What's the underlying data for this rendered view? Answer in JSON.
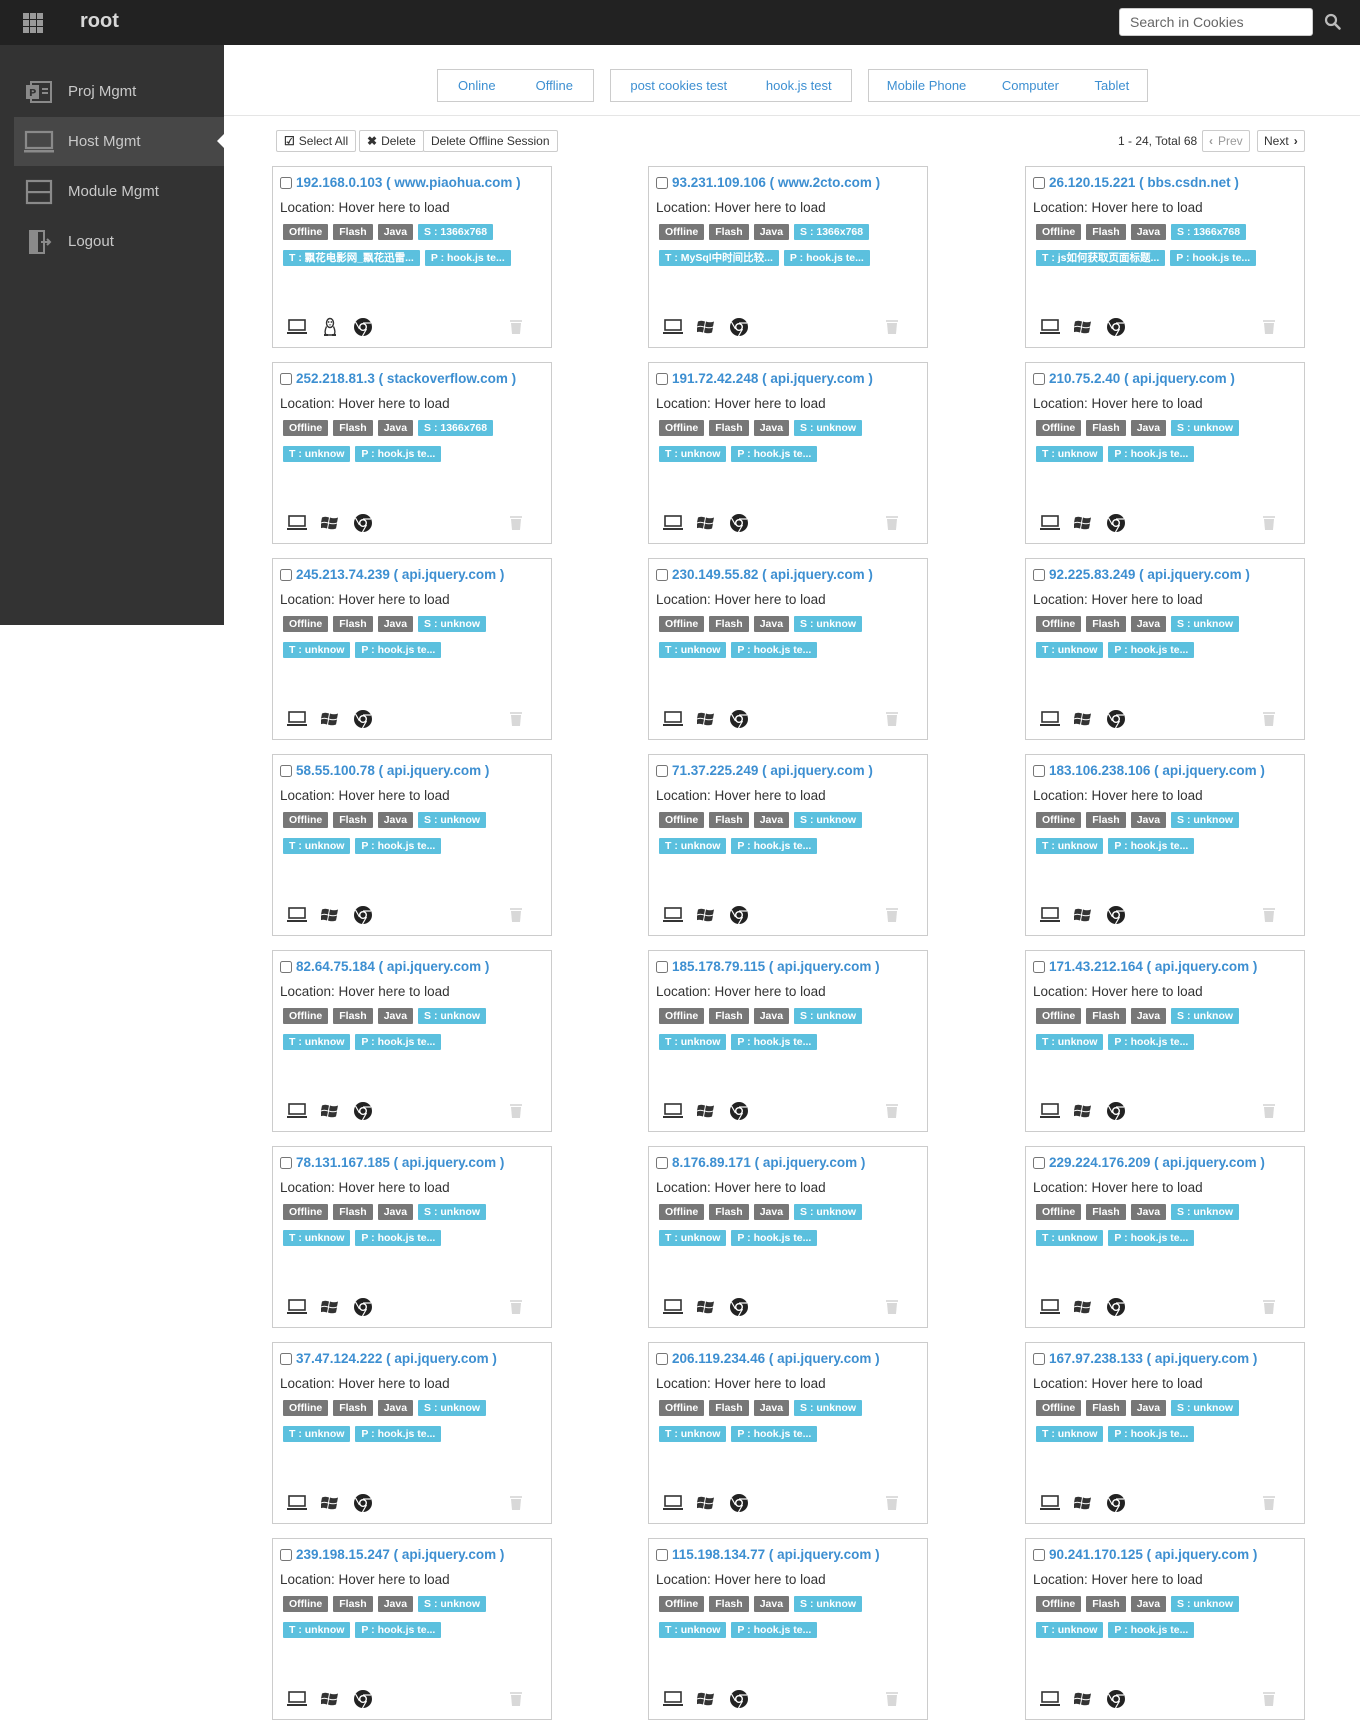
{
  "app": {
    "title": "root"
  },
  "search": {
    "placeholder": "Search in Cookies"
  },
  "sidebar": {
    "items": [
      {
        "label": "Proj Mgmt",
        "icon": "project-icon",
        "active": false
      },
      {
        "label": "Host Mgmt",
        "icon": "monitor-icon",
        "active": true
      },
      {
        "label": "Module Mgmt",
        "icon": "module-icon",
        "active": false
      },
      {
        "label": "Logout",
        "icon": "logout-icon",
        "active": false
      }
    ]
  },
  "filters": {
    "status": [
      "Online",
      "Offline"
    ],
    "modules": [
      "post cookies test",
      "hook.js test"
    ],
    "devices": [
      "Mobile Phone",
      "Computer",
      "Tablet"
    ]
  },
  "toolbar": {
    "select_all": "Select All",
    "delete": "Delete",
    "delete_offline": "Delete Offline Session"
  },
  "pager": {
    "info": "1 - 24, Total 68",
    "prev": "Prev",
    "next": "Next"
  },
  "colors": {
    "link": "#3d8fd1",
    "tag_gray": "#777777",
    "tag_blue": "#5bc0de",
    "topbar": "#222222",
    "sidebar": "#333333"
  },
  "host_common": {
    "location": "Location: Hover here to load",
    "status_tag": "Offline",
    "flash_tag": "Flash",
    "java_tag": "Java",
    "device_icon": "computer-icon",
    "browser_icon": "chrome-icon",
    "delete_icon": "trash-icon"
  },
  "hosts": [
    {
      "title": "192.168.0.103 ( www.piaohua.com )",
      "screen": "S : 1366x768",
      "target": "T : 飘花电影网_飘花迅雷...",
      "module": "P : hook.js te...",
      "os_icon": "linux-icon"
    },
    {
      "title": "93.231.109.106 ( www.2cto.com )",
      "screen": "S : 1366x768",
      "target": "T : MySql中时间比较...",
      "module": "P : hook.js te...",
      "os_icon": "windows-icon"
    },
    {
      "title": "26.120.15.221 ( bbs.csdn.net )",
      "screen": "S : 1366x768",
      "target": "T : js如何获取页面标题...",
      "module": "P : hook.js te...",
      "os_icon": "windows-icon"
    },
    {
      "title": "252.218.81.3 ( stackoverflow.com )",
      "screen": "S : 1366x768",
      "target": "T : unknow",
      "module": "P : hook.js te...",
      "os_icon": "windows-icon"
    },
    {
      "title": "191.72.42.248 ( api.jquery.com )",
      "screen": "S : unknow",
      "target": "T : unknow",
      "module": "P : hook.js te...",
      "os_icon": "windows-icon"
    },
    {
      "title": "210.75.2.40 ( api.jquery.com )",
      "screen": "S : unknow",
      "target": "T : unknow",
      "module": "P : hook.js te...",
      "os_icon": "windows-icon"
    },
    {
      "title": "245.213.74.239 ( api.jquery.com )",
      "screen": "S : unknow",
      "target": "T : unknow",
      "module": "P : hook.js te...",
      "os_icon": "windows-icon"
    },
    {
      "title": "230.149.55.82 ( api.jquery.com )",
      "screen": "S : unknow",
      "target": "T : unknow",
      "module": "P : hook.js te...",
      "os_icon": "windows-icon"
    },
    {
      "title": "92.225.83.249 ( api.jquery.com )",
      "screen": "S : unknow",
      "target": "T : unknow",
      "module": "P : hook.js te...",
      "os_icon": "windows-icon"
    },
    {
      "title": "58.55.100.78 ( api.jquery.com )",
      "screen": "S : unknow",
      "target": "T : unknow",
      "module": "P : hook.js te...",
      "os_icon": "windows-icon"
    },
    {
      "title": "71.37.225.249 ( api.jquery.com )",
      "screen": "S : unknow",
      "target": "T : unknow",
      "module": "P : hook.js te...",
      "os_icon": "windows-icon"
    },
    {
      "title": "183.106.238.106 ( api.jquery.com )",
      "screen": "S : unknow",
      "target": "T : unknow",
      "module": "P : hook.js te...",
      "os_icon": "windows-icon"
    },
    {
      "title": "82.64.75.184 ( api.jquery.com )",
      "screen": "S : unknow",
      "target": "T : unknow",
      "module": "P : hook.js te...",
      "os_icon": "windows-icon"
    },
    {
      "title": "185.178.79.115 ( api.jquery.com )",
      "screen": "S : unknow",
      "target": "T : unknow",
      "module": "P : hook.js te...",
      "os_icon": "windows-icon"
    },
    {
      "title": "171.43.212.164 ( api.jquery.com )",
      "screen": "S : unknow",
      "target": "T : unknow",
      "module": "P : hook.js te...",
      "os_icon": "windows-icon"
    },
    {
      "title": "78.131.167.185 ( api.jquery.com )",
      "screen": "S : unknow",
      "target": "T : unknow",
      "module": "P : hook.js te...",
      "os_icon": "windows-icon"
    },
    {
      "title": "8.176.89.171 ( api.jquery.com )",
      "screen": "S : unknow",
      "target": "T : unknow",
      "module": "P : hook.js te...",
      "os_icon": "windows-icon"
    },
    {
      "title": "229.224.176.209 ( api.jquery.com )",
      "screen": "S : unknow",
      "target": "T : unknow",
      "module": "P : hook.js te...",
      "os_icon": "windows-icon"
    },
    {
      "title": "37.47.124.222 ( api.jquery.com )",
      "screen": "S : unknow",
      "target": "T : unknow",
      "module": "P : hook.js te...",
      "os_icon": "windows-icon"
    },
    {
      "title": "206.119.234.46 ( api.jquery.com )",
      "screen": "S : unknow",
      "target": "T : unknow",
      "module": "P : hook.js te...",
      "os_icon": "windows-icon"
    },
    {
      "title": "167.97.238.133 ( api.jquery.com )",
      "screen": "S : unknow",
      "target": "T : unknow",
      "module": "P : hook.js te...",
      "os_icon": "windows-icon"
    },
    {
      "title": "239.198.15.247 ( api.jquery.com )",
      "screen": "S : unknow",
      "target": "T : unknow",
      "module": "P : hook.js te...",
      "os_icon": "windows-icon"
    },
    {
      "title": "115.198.134.77 ( api.jquery.com )",
      "screen": "S : unknow",
      "target": "T : unknow",
      "module": "P : hook.js te...",
      "os_icon": "windows-icon"
    },
    {
      "title": "90.241.170.125 ( api.jquery.com )",
      "screen": "S : unknow",
      "target": "T : unknow",
      "module": "P : hook.js te...",
      "os_icon": "windows-icon"
    }
  ]
}
